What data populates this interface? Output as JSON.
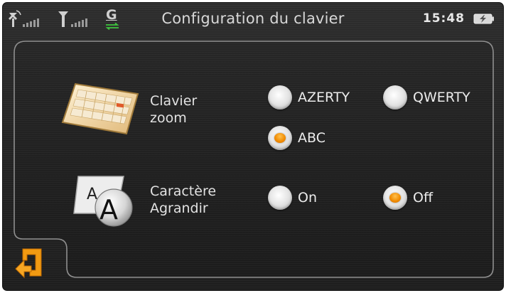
{
  "status_bar": {
    "title": "Configuration du clavier",
    "clock": "15:48",
    "network_letter": "G"
  },
  "settings": {
    "keyboard": {
      "label_line1": "Clavier",
      "label_line2": "zoom",
      "options": [
        {
          "label": "AZERTY",
          "selected": false
        },
        {
          "label": "QWERTY",
          "selected": false
        },
        {
          "label": "ABC",
          "selected": true
        }
      ]
    },
    "char_enlarge": {
      "label_line1": "Caractère",
      "label_line2": "Agrandir",
      "options": [
        {
          "label": "On",
          "selected": false
        },
        {
          "label": "Off",
          "selected": true
        }
      ]
    }
  },
  "colors": {
    "accent": "#f08a00",
    "text": "#e2e2e2"
  }
}
